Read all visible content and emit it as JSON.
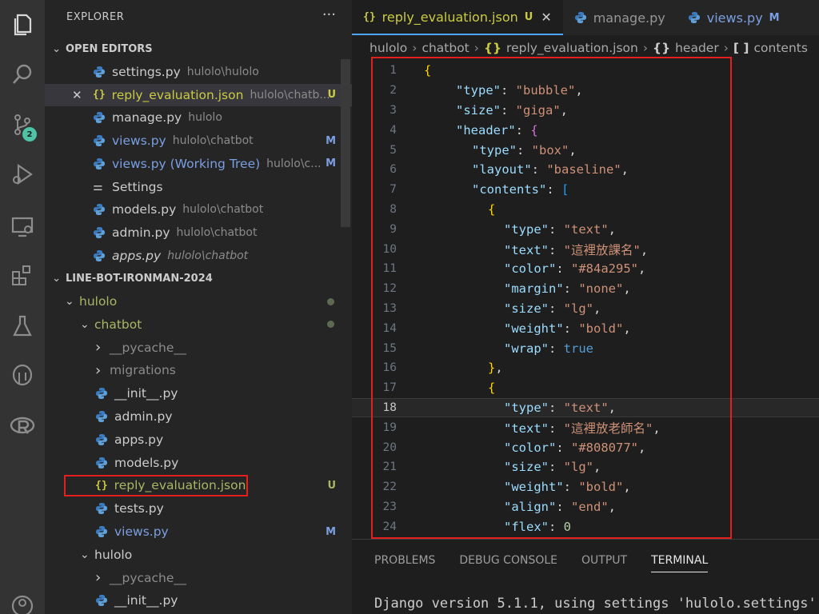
{
  "explorer": {
    "title": "EXPLORER",
    "more": "···",
    "open_editors_label": "OPEN EDITORS",
    "open_editors": [
      {
        "name": "settings.py",
        "path": "hulolo\\hulolo",
        "status": "",
        "icon": "python-icon",
        "color": "#cccccc"
      },
      {
        "name": "reply_evaluation.json",
        "path": "hulolo\\chatb...",
        "status": "U",
        "icon": "json-icon",
        "color": "#cbcb41",
        "active": true
      },
      {
        "name": "manage.py",
        "path": "hulolo",
        "status": "",
        "icon": "python-icon",
        "color": "#cccccc"
      },
      {
        "name": "views.py",
        "path": "hulolo\\chatbot",
        "status": "M",
        "icon": "python-icon",
        "color": "#7a9fe0"
      },
      {
        "name": "views.py (Working Tree)",
        "path": "hulolo\\c...",
        "status": "M",
        "icon": "python-icon",
        "color": "#7a9fe0"
      },
      {
        "name": "Settings",
        "path": "",
        "status": "",
        "icon": "settings-icon",
        "color": "#cccccc"
      },
      {
        "name": "models.py",
        "path": "hulolo\\chatbot",
        "status": "",
        "icon": "python-icon",
        "color": "#cccccc"
      },
      {
        "name": "admin.py",
        "path": "hulolo\\chatbot",
        "status": "",
        "icon": "python-icon",
        "color": "#cccccc"
      },
      {
        "name": "apps.py",
        "path": "hulolo\\chatbot",
        "status": "",
        "icon": "python-icon",
        "color": "#cccccc",
        "italic": true
      }
    ],
    "project_label": "LINE-BOT-IRONMAN-2024",
    "tree": [
      {
        "name": "hulolo",
        "type": "folder-open",
        "indent": 1,
        "color": "#a9b665",
        "dot": true
      },
      {
        "name": "chatbot",
        "type": "folder-open",
        "indent": 2,
        "color": "#a9b665",
        "dot": true
      },
      {
        "name": "__pycache__",
        "type": "folder",
        "indent": 3,
        "color": "#8b8b8b"
      },
      {
        "name": "migrations",
        "type": "folder",
        "indent": 3,
        "color": "#8b8b8b"
      },
      {
        "name": "__init__.py",
        "type": "python",
        "indent": 3,
        "color": "#cccccc"
      },
      {
        "name": "admin.py",
        "type": "python",
        "indent": 3,
        "color": "#cccccc"
      },
      {
        "name": "apps.py",
        "type": "python",
        "indent": 3,
        "color": "#cccccc"
      },
      {
        "name": "models.py",
        "type": "python",
        "indent": 3,
        "color": "#cccccc"
      },
      {
        "name": "reply_evaluation.json",
        "type": "json",
        "indent": 3,
        "color": "#a9b665",
        "status": "U"
      },
      {
        "name": "tests.py",
        "type": "python",
        "indent": 3,
        "color": "#cccccc"
      },
      {
        "name": "views.py",
        "type": "python",
        "indent": 3,
        "color": "#7a9fe0",
        "status": "M"
      },
      {
        "name": "hulolo",
        "type": "folder-open",
        "indent": 2,
        "color": "#cccccc"
      },
      {
        "name": "__pycache__",
        "type": "folder",
        "indent": 3,
        "color": "#8b8b8b"
      },
      {
        "name": "__init__.py",
        "type": "python",
        "indent": 3,
        "color": "#cccccc"
      }
    ]
  },
  "activity_bar": {
    "icons": [
      "explorer-icon",
      "search-icon",
      "source-control-icon",
      "run-debug-icon",
      "remote-explorer-icon",
      "extensions-icon",
      "testing-icon",
      "postgresql-icon",
      "r-language-icon",
      "account-icon"
    ],
    "source_control_badge": "2"
  },
  "tabs": [
    {
      "label": "reply_evaluation.json",
      "icon": "{}",
      "status": "U",
      "active": true,
      "close": "✕"
    },
    {
      "label": "manage.py",
      "icon": "python-icon",
      "status": "",
      "active": false
    },
    {
      "label": "views.py",
      "icon": "python-icon",
      "status": "M",
      "active": false
    }
  ],
  "breadcrumb": [
    {
      "label": "hulolo"
    },
    {
      "label": "chatbot"
    },
    {
      "label": "reply_evaluation.json",
      "icon": "{}"
    },
    {
      "label": "header",
      "icon": "{}"
    },
    {
      "label": "contents",
      "icon": "[ ]"
    }
  ],
  "editor": {
    "current_line": 18,
    "lines": [
      {
        "n": "1",
        "tokens": [
          [
            "b1",
            "{"
          ]
        ],
        "indent": 0
      },
      {
        "n": "2",
        "tokens": [
          [
            "k",
            "\"type\""
          ],
          [
            "p",
            ": "
          ],
          [
            "s",
            "\"bubble\""
          ],
          [
            "p",
            ","
          ]
        ],
        "indent": 2
      },
      {
        "n": "3",
        "tokens": [
          [
            "k",
            "\"size\""
          ],
          [
            "p",
            ": "
          ],
          [
            "s",
            "\"giga\""
          ],
          [
            "p",
            ","
          ]
        ],
        "indent": 2
      },
      {
        "n": "4",
        "tokens": [
          [
            "k",
            "\"header\""
          ],
          [
            "p",
            ": "
          ],
          [
            "b2",
            "{"
          ]
        ],
        "indent": 2
      },
      {
        "n": "5",
        "tokens": [
          [
            "k",
            "\"type\""
          ],
          [
            "p",
            ": "
          ],
          [
            "s",
            "\"box\""
          ],
          [
            "p",
            ","
          ]
        ],
        "indent": 3
      },
      {
        "n": "6",
        "tokens": [
          [
            "k",
            "\"layout\""
          ],
          [
            "p",
            ": "
          ],
          [
            "s",
            "\"baseline\""
          ],
          [
            "p",
            ","
          ]
        ],
        "indent": 3
      },
      {
        "n": "7",
        "tokens": [
          [
            "k",
            "\"contents\""
          ],
          [
            "p",
            ": "
          ],
          [
            "b3",
            "["
          ]
        ],
        "indent": 3
      },
      {
        "n": "8",
        "tokens": [
          [
            "b1",
            "{"
          ]
        ],
        "indent": 4
      },
      {
        "n": "9",
        "tokens": [
          [
            "k",
            "\"type\""
          ],
          [
            "p",
            ": "
          ],
          [
            "s",
            "\"text\""
          ],
          [
            "p",
            ","
          ]
        ],
        "indent": 5
      },
      {
        "n": "10",
        "tokens": [
          [
            "k",
            "\"text\""
          ],
          [
            "p",
            ": "
          ],
          [
            "s",
            "\"這裡放課名\""
          ],
          [
            "p",
            ","
          ]
        ],
        "indent": 5
      },
      {
        "n": "11",
        "tokens": [
          [
            "k",
            "\"color\""
          ],
          [
            "p",
            ": "
          ],
          [
            "s",
            "\"#84a295\""
          ],
          [
            "p",
            ","
          ]
        ],
        "indent": 5
      },
      {
        "n": "12",
        "tokens": [
          [
            "k",
            "\"margin\""
          ],
          [
            "p",
            ": "
          ],
          [
            "s",
            "\"none\""
          ],
          [
            "p",
            ","
          ]
        ],
        "indent": 5
      },
      {
        "n": "13",
        "tokens": [
          [
            "k",
            "\"size\""
          ],
          [
            "p",
            ": "
          ],
          [
            "s",
            "\"lg\""
          ],
          [
            "p",
            ","
          ]
        ],
        "indent": 5
      },
      {
        "n": "14",
        "tokens": [
          [
            "k",
            "\"weight\""
          ],
          [
            "p",
            ": "
          ],
          [
            "s",
            "\"bold\""
          ],
          [
            "p",
            ","
          ]
        ],
        "indent": 5
      },
      {
        "n": "15",
        "tokens": [
          [
            "k",
            "\"wrap\""
          ],
          [
            "p",
            ": "
          ],
          [
            "kw",
            "true"
          ]
        ],
        "indent": 5
      },
      {
        "n": "16",
        "tokens": [
          [
            "b1",
            "}"
          ],
          [
            "p",
            ","
          ]
        ],
        "indent": 4
      },
      {
        "n": "17",
        "tokens": [
          [
            "b1",
            "{"
          ]
        ],
        "indent": 4
      },
      {
        "n": "18",
        "tokens": [
          [
            "k",
            "\"type\""
          ],
          [
            "p",
            ": "
          ],
          [
            "s",
            "\"text\""
          ],
          [
            "p",
            ","
          ]
        ],
        "indent": 5
      },
      {
        "n": "19",
        "tokens": [
          [
            "k",
            "\"text\""
          ],
          [
            "p",
            ": "
          ],
          [
            "s",
            "\"這裡放老師名\""
          ],
          [
            "p",
            ","
          ]
        ],
        "indent": 5
      },
      {
        "n": "20",
        "tokens": [
          [
            "k",
            "\"color\""
          ],
          [
            "p",
            ": "
          ],
          [
            "s",
            "\"#808077\""
          ],
          [
            "p",
            ","
          ]
        ],
        "indent": 5
      },
      {
        "n": "21",
        "tokens": [
          [
            "k",
            "\"size\""
          ],
          [
            "p",
            ": "
          ],
          [
            "s",
            "\"lg\""
          ],
          [
            "p",
            ","
          ]
        ],
        "indent": 5
      },
      {
        "n": "22",
        "tokens": [
          [
            "k",
            "\"weight\""
          ],
          [
            "p",
            ": "
          ],
          [
            "s",
            "\"bold\""
          ],
          [
            "p",
            ","
          ]
        ],
        "indent": 5
      },
      {
        "n": "23",
        "tokens": [
          [
            "k",
            "\"align\""
          ],
          [
            "p",
            ": "
          ],
          [
            "s",
            "\"end\""
          ],
          [
            "p",
            ","
          ]
        ],
        "indent": 5
      },
      {
        "n": "24",
        "tokens": [
          [
            "k",
            "\"flex\""
          ],
          [
            "p",
            ": "
          ],
          [
            "num",
            "0"
          ]
        ],
        "indent": 5
      }
    ]
  },
  "panel": {
    "tabs": [
      {
        "label": "PROBLEMS",
        "active": false
      },
      {
        "label": "DEBUG CONSOLE",
        "active": false
      },
      {
        "label": "OUTPUT",
        "active": false
      },
      {
        "label": "TERMINAL",
        "active": true
      }
    ],
    "terminal_text": "Django version 5.1.1, using settings 'hulolo.settings'"
  },
  "colors": {
    "accent_tab_border": "#4fa6ff",
    "highlight_box": "#e51e1e",
    "json_file": "#cbcb41",
    "modified": "#7a9fe0",
    "untracked": "#a9b665"
  }
}
